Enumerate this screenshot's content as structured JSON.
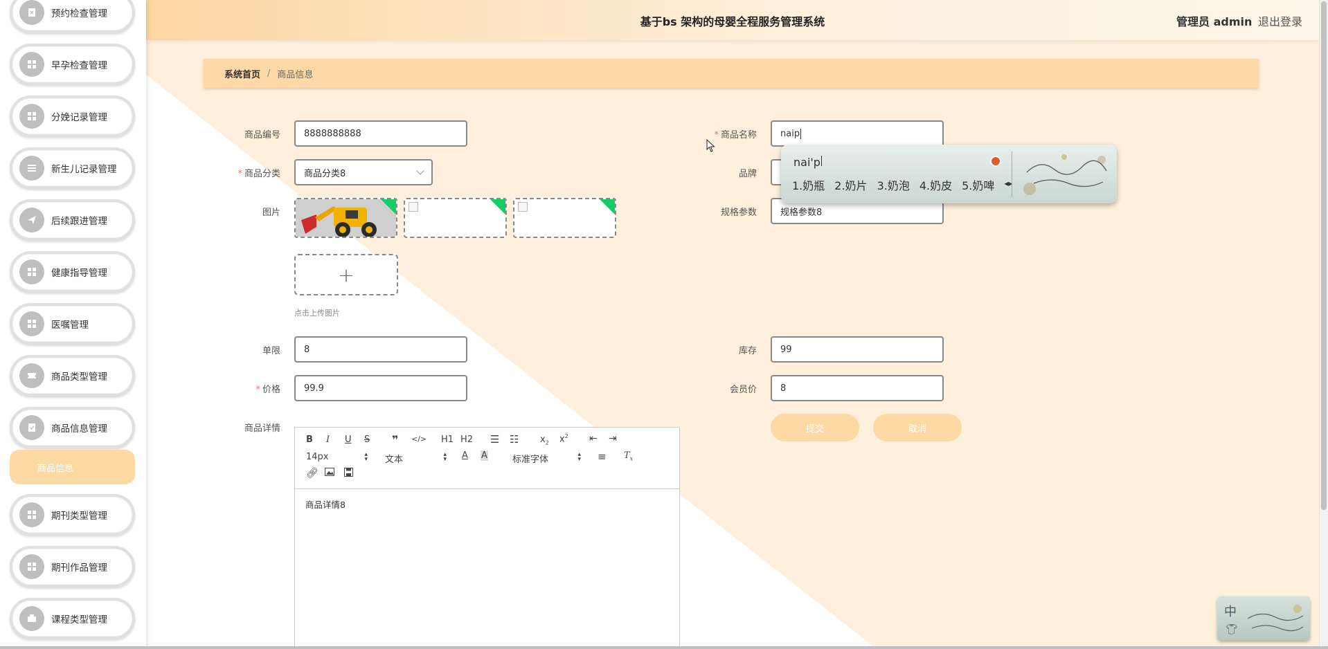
{
  "header": {
    "title": "基于bs 架构的母婴全程服务管理系统",
    "admin": "管理员 admin",
    "logout": "退出登录"
  },
  "sidebar": {
    "items": [
      {
        "label": "预约检查管理",
        "icon": "document-icon"
      },
      {
        "label": "早孕检查管理",
        "icon": "grid-icon"
      },
      {
        "label": "分娩记录管理",
        "icon": "grid-icon"
      },
      {
        "label": "新生儿记录管理",
        "icon": "list-icon"
      },
      {
        "label": "后续跟进管理",
        "icon": "send-icon"
      },
      {
        "label": "健康指导管理",
        "icon": "grid-icon"
      },
      {
        "label": "医嘱管理",
        "icon": "grid-icon"
      },
      {
        "label": "商品类型管理",
        "icon": "ticket-icon"
      },
      {
        "label": "商品信息管理",
        "icon": "checklist-icon"
      },
      {
        "label": "期刊类型管理",
        "icon": "grid-icon"
      },
      {
        "label": "期刊作品管理",
        "icon": "grid-icon"
      },
      {
        "label": "课程类型管理",
        "icon": "wallet-icon"
      }
    ],
    "active_sub": "商品信息"
  },
  "breadcrumb": {
    "home": "系统首页",
    "separator": "/",
    "current": "商品信息"
  },
  "form": {
    "code_label": "商品编号",
    "code_value": "8888888888",
    "name_label": "商品名称",
    "name_value": "naip",
    "category_label": "商品分类",
    "category_value": "商品分类8",
    "brand_label": "品牌",
    "image_label": "图片",
    "spec_label": "规格参数",
    "spec_value": "规格参数8",
    "upload_hint": "点击上传图片",
    "limit_label": "单限",
    "limit_value": "8",
    "stock_label": "库存",
    "stock_value": "99",
    "price_label": "价格",
    "price_value": "99.9",
    "member_price_label": "会员价",
    "member_price_value": "8",
    "detail_label": "商品详情",
    "submit": "提交",
    "cancel": "取消"
  },
  "editor": {
    "font_size": "14px",
    "heading": "文本",
    "font_family": "标准字体",
    "h1": "H1",
    "h2": "H2",
    "content": "商品详情8"
  },
  "ime": {
    "composition": "nai'p",
    "candidates": [
      "1.奶瓶",
      "2.奶片",
      "3.奶泡",
      "4.奶皮",
      "5.奶啤"
    ],
    "mode": "中"
  },
  "colors": {
    "accent": "#fdd9a3",
    "required": "#f56c6c",
    "upload_corner": "#13ce66"
  }
}
